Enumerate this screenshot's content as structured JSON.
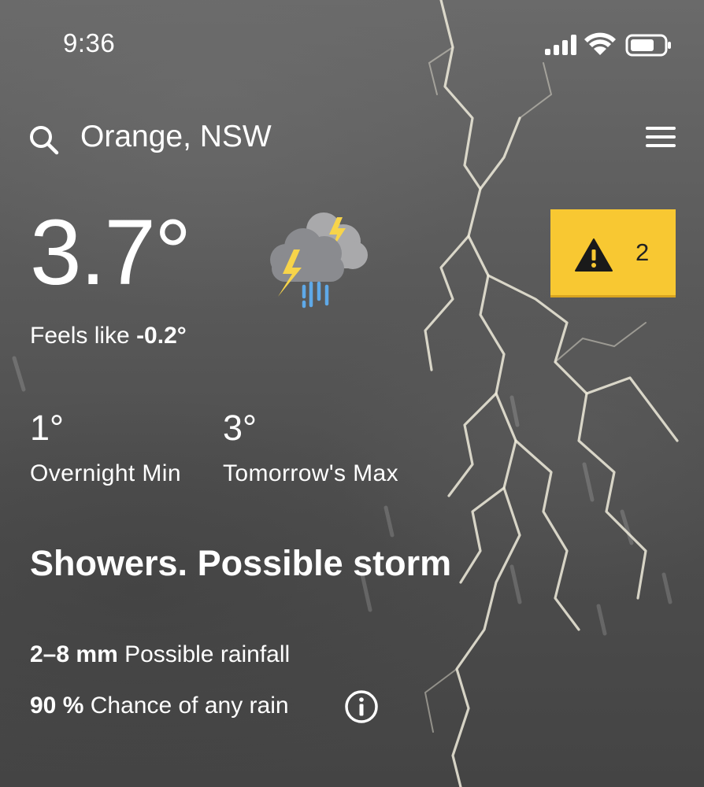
{
  "status_bar": {
    "time": "9:36"
  },
  "location": {
    "name": "Orange, NSW"
  },
  "current": {
    "temperature": "3.7°",
    "feels_like_label": "Feels like",
    "feels_like_value": "-0.2°",
    "weather_icon": "thunderstorm-showers-icon"
  },
  "warnings": {
    "count": "2",
    "icon": "warning-triangle-icon",
    "color": "#f8c832"
  },
  "forecast": {
    "overnight_min_value": "1°",
    "overnight_min_label": "Overnight Min",
    "tomorrow_max_value": "3°",
    "tomorrow_max_label": "Tomorrow's Max"
  },
  "summary": "Showers. Possible storm",
  "rainfall": {
    "amount": "2–8 mm",
    "amount_label": "Possible rainfall",
    "chance": "90 %",
    "chance_label": "Chance of any rain"
  }
}
